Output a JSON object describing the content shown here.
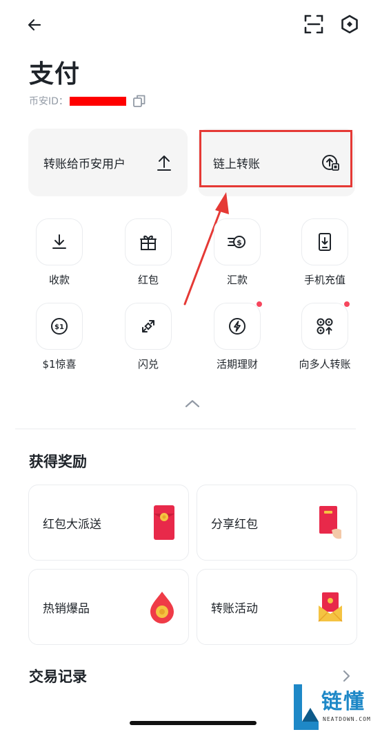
{
  "header": {
    "title": "支付",
    "id_label": "币安ID："
  },
  "transfer": {
    "to_user_label": "转账给币安用户",
    "onchain_label": "链上转账"
  },
  "actions": [
    {
      "label": "收款",
      "icon": "download-icon",
      "dot": false
    },
    {
      "label": "红包",
      "icon": "gift-icon",
      "dot": false
    },
    {
      "label": "汇款",
      "icon": "remittance-icon",
      "dot": false
    },
    {
      "label": "手机充值",
      "icon": "phone-topup-icon",
      "dot": false
    },
    {
      "label": "$1惊喜",
      "icon": "one-dollar-icon",
      "dot": false
    },
    {
      "label": "闪兑",
      "icon": "convert-icon",
      "dot": false
    },
    {
      "label": "活期理财",
      "icon": "lightning-icon",
      "dot": true
    },
    {
      "label": "向多人转账",
      "icon": "multi-transfer-icon",
      "dot": true
    }
  ],
  "rewards": {
    "title": "获得奖励",
    "items": [
      {
        "label": "红包大派送",
        "icon": "red-envelope-icon"
      },
      {
        "label": "分享红包",
        "icon": "share-envelope-icon"
      },
      {
        "label": "热销爆品",
        "icon": "fire-drop-icon"
      },
      {
        "label": "转账活动",
        "icon": "gift-envelope-icon"
      }
    ]
  },
  "history": {
    "title": "交易记录"
  },
  "watermark": {
    "text": "链懂",
    "sub": "NEATDOWN.COM"
  },
  "colors": {
    "accent_red": "#e53935",
    "notification_dot": "#f6465d",
    "envelope_red": "#e8294a",
    "watermark_blue": "#1e88c7"
  }
}
